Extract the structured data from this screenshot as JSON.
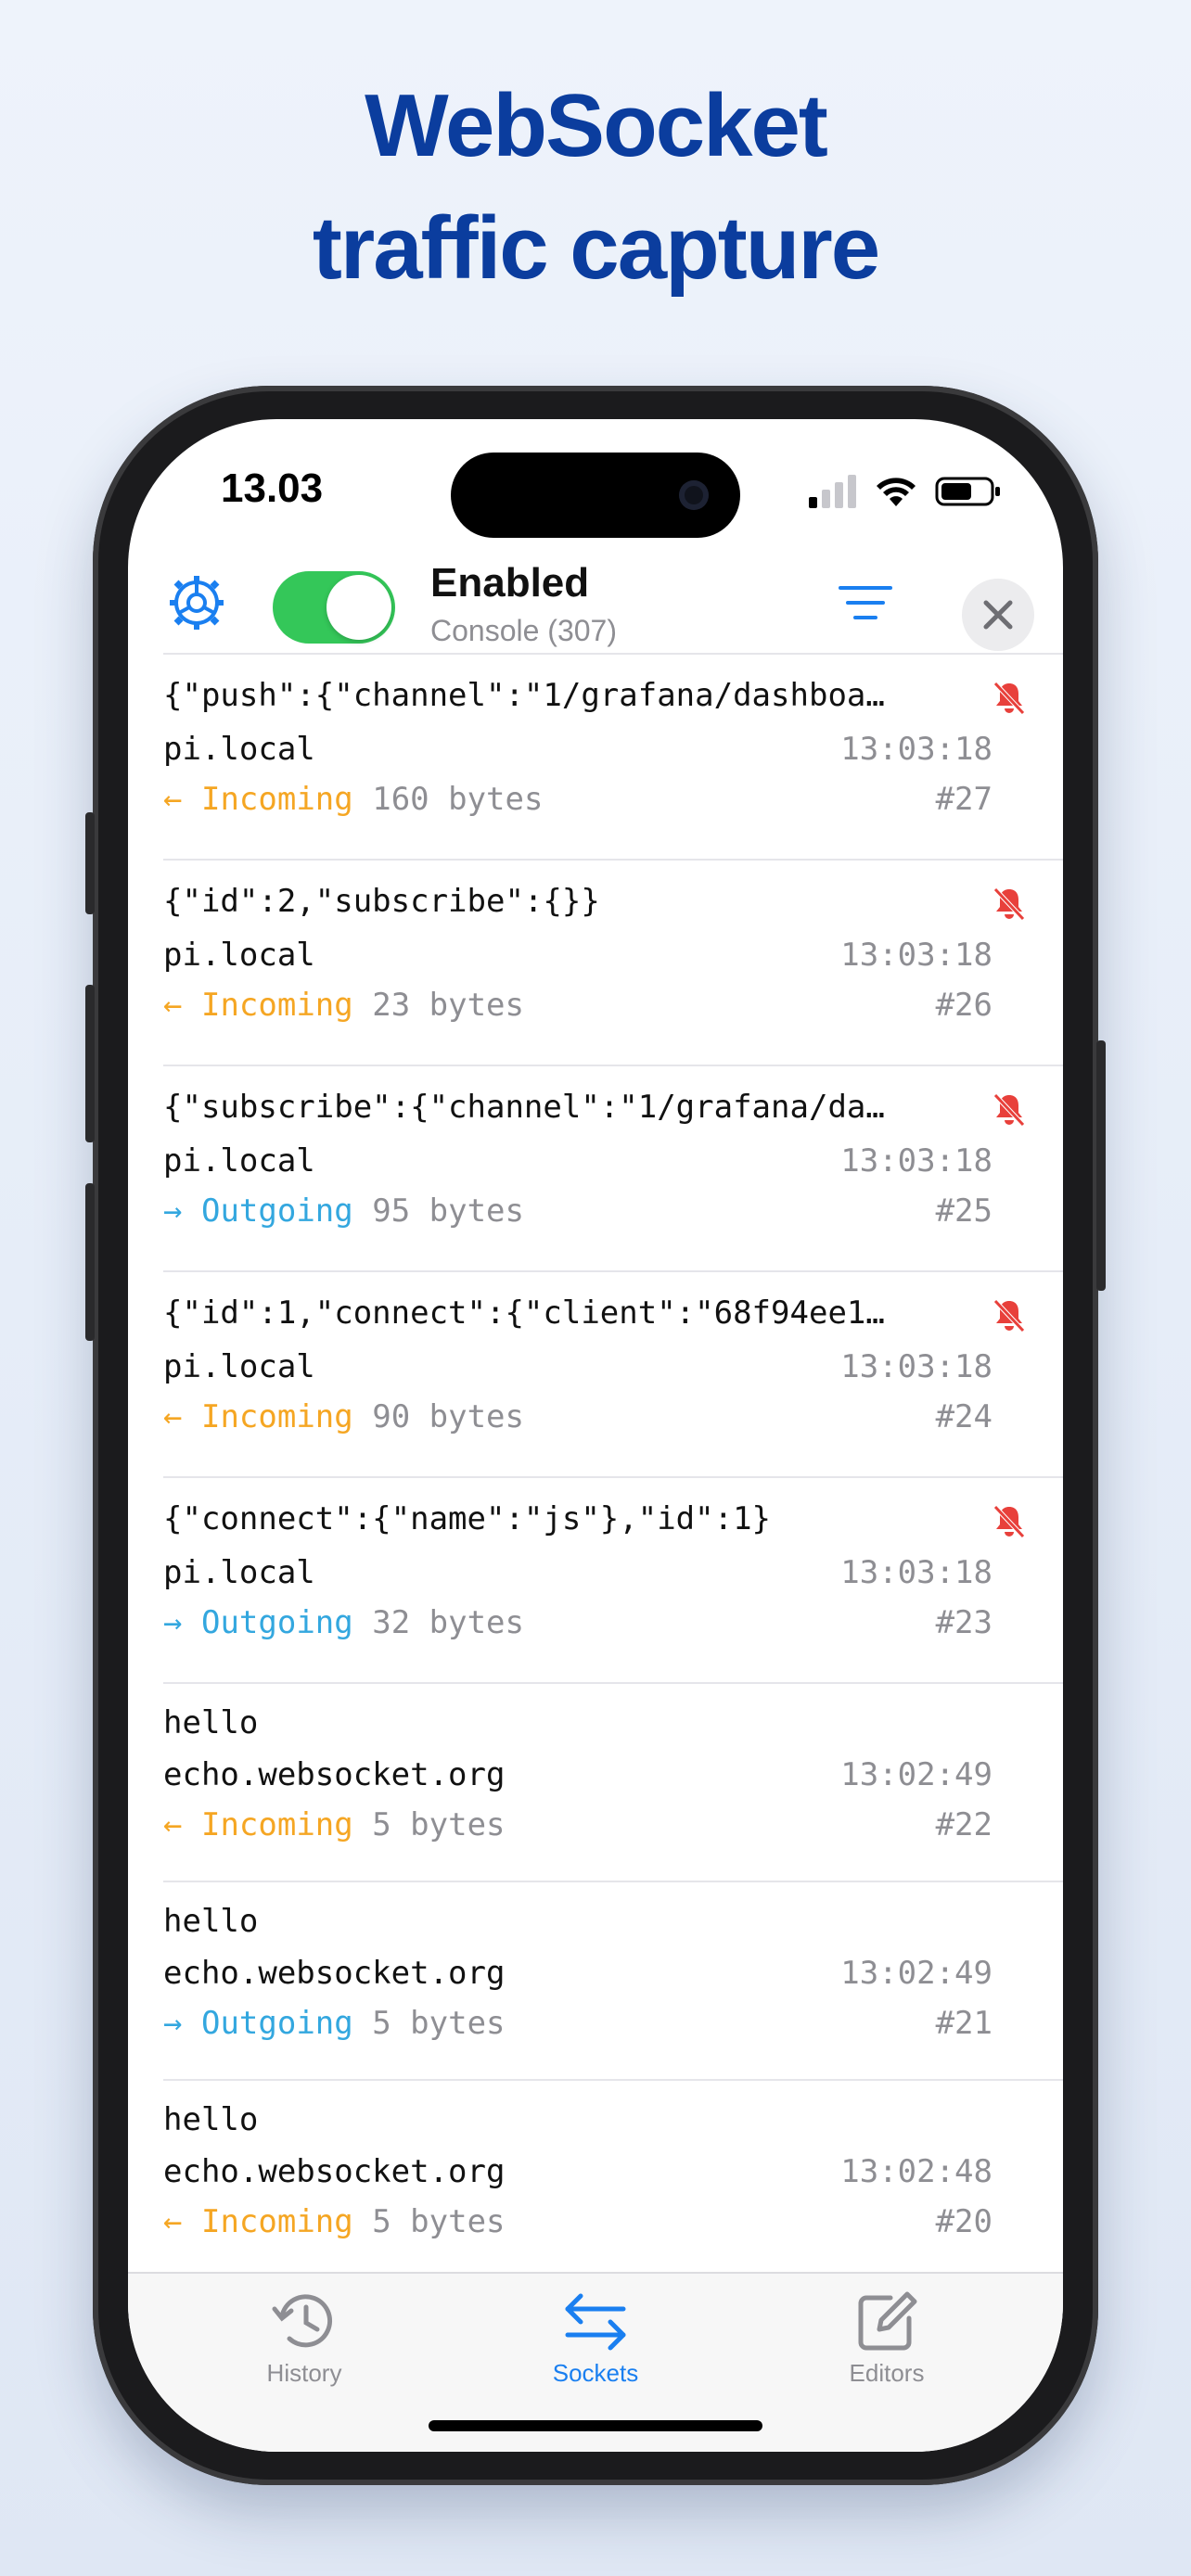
{
  "headline": {
    "line1": "WebSocket",
    "line2": "traffic capture"
  },
  "status_bar": {
    "time": "13.03"
  },
  "toolbar": {
    "toggle_on": true,
    "title": "Enabled",
    "subtitle": "Console (307)",
    "settings_icon": "gear-icon",
    "filter_icon": "filter-icon",
    "close_icon": "close-icon"
  },
  "colors": {
    "incoming": "#f5a623",
    "outgoing": "#33a7df",
    "toggle": "#34c759",
    "accent": "#1a7ff0",
    "mute": "#e8403b"
  },
  "messages": [
    {
      "payload": "{\"push\":{\"channel\":\"1/grafana/dashboa…",
      "host": "pi.local",
      "time": "13:03:18",
      "direction": "Incoming",
      "arrow": "←",
      "size": "160 bytes",
      "num": "#27",
      "muted": true
    },
    {
      "payload": "{\"id\":2,\"subscribe\":{}}",
      "host": "pi.local",
      "time": "13:03:18",
      "direction": "Incoming",
      "arrow": "←",
      "size": "23 bytes",
      "num": "#26",
      "muted": true
    },
    {
      "payload": "{\"subscribe\":{\"channel\":\"1/grafana/da…",
      "host": "pi.local",
      "time": "13:03:18",
      "direction": "Outgoing",
      "arrow": "→",
      "size": "95 bytes",
      "num": "#25",
      "muted": true
    },
    {
      "payload": "{\"id\":1,\"connect\":{\"client\":\"68f94ee1…",
      "host": "pi.local",
      "time": "13:03:18",
      "direction": "Incoming",
      "arrow": "←",
      "size": "90 bytes",
      "num": "#24",
      "muted": true
    },
    {
      "payload": "{\"connect\":{\"name\":\"js\"},\"id\":1}",
      "host": "pi.local",
      "time": "13:03:18",
      "direction": "Outgoing",
      "arrow": "→",
      "size": "32 bytes",
      "num": "#23",
      "muted": true
    },
    {
      "payload": "hello",
      "host": "echo.websocket.org",
      "time": "13:02:49",
      "direction": "Incoming",
      "arrow": "←",
      "size": "5 bytes",
      "num": "#22",
      "muted": false
    },
    {
      "payload": "hello",
      "host": "echo.websocket.org",
      "time": "13:02:49",
      "direction": "Outgoing",
      "arrow": "→",
      "size": "5 bytes",
      "num": "#21",
      "muted": false
    },
    {
      "payload": "hello",
      "host": "echo.websocket.org",
      "time": "13:02:48",
      "direction": "Incoming",
      "arrow": "←",
      "size": "5 bytes",
      "num": "#20",
      "muted": false
    }
  ],
  "tabs": [
    {
      "label": "History",
      "icon": "history-icon",
      "active": false
    },
    {
      "label": "Sockets",
      "icon": "sockets-icon",
      "active": true
    },
    {
      "label": "Editors",
      "icon": "editors-icon",
      "active": false
    }
  ]
}
